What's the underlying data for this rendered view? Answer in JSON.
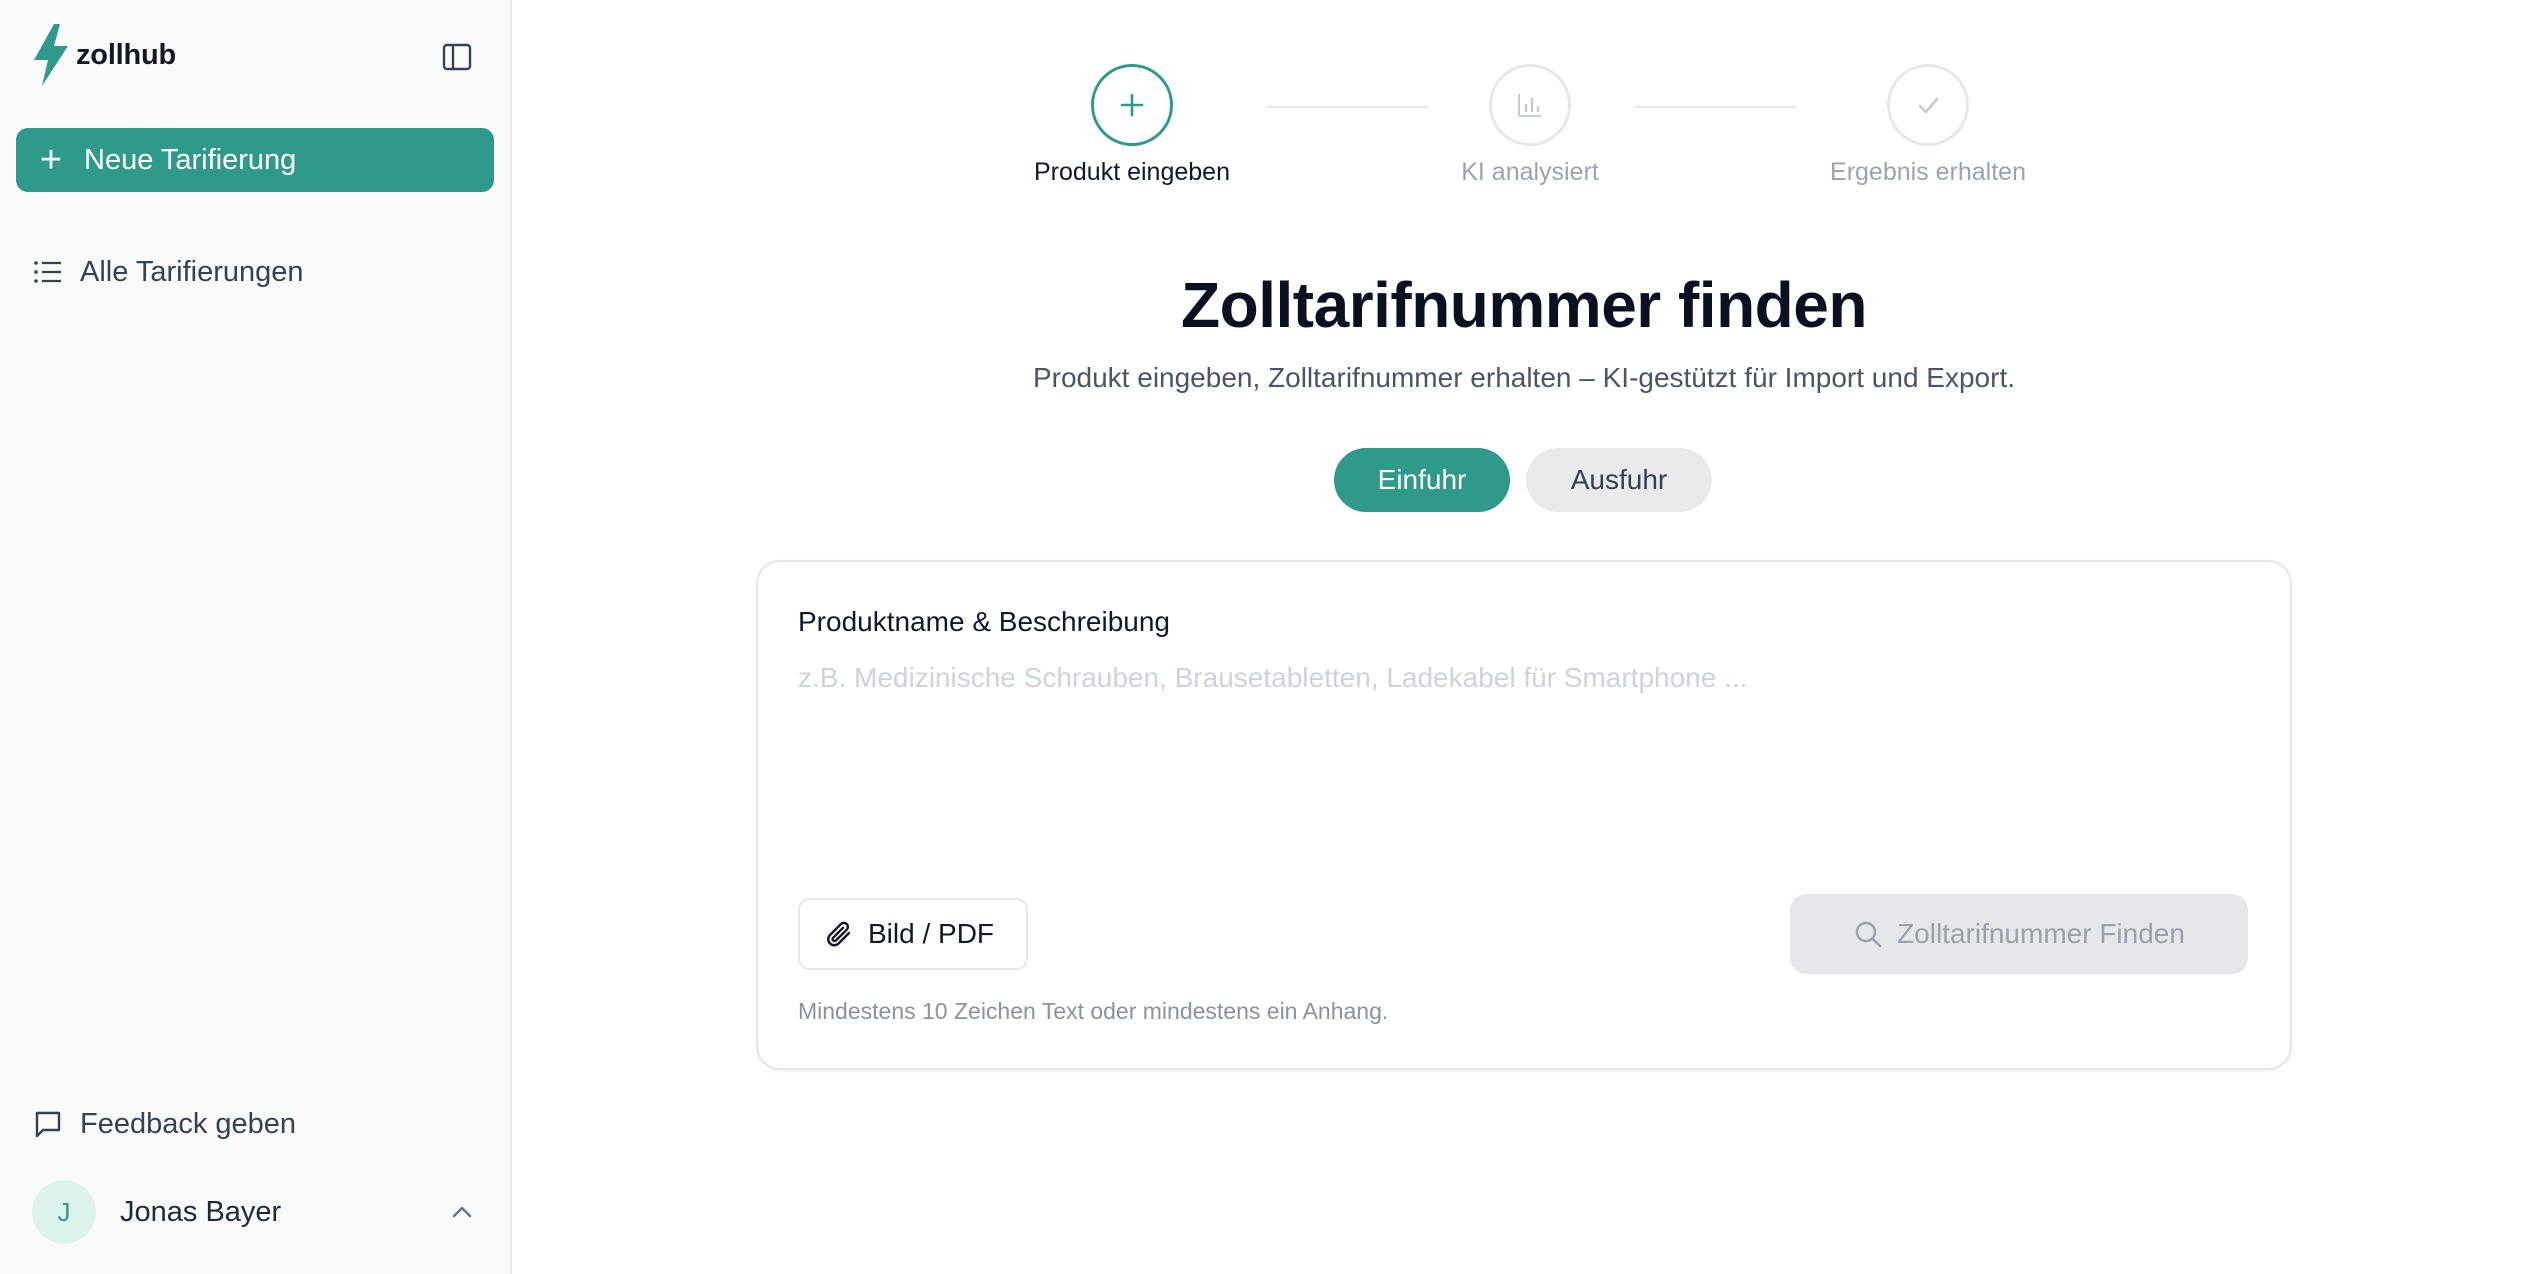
{
  "app": {
    "name": "zollhub",
    "brand_color": "#2f9a8a"
  },
  "sidebar": {
    "new_button_label": "Neue Tarifierung",
    "all_label": "Alle Tarifierungen",
    "feedback_label": "Feedback geben",
    "user": {
      "initial": "J",
      "name": "Jonas Bayer"
    }
  },
  "steps": [
    {
      "label": "Produkt eingeben",
      "icon": "plus-icon",
      "state": "active"
    },
    {
      "label": "KI analysiert",
      "icon": "bar-chart-icon",
      "state": "inactive"
    },
    {
      "label": "Ergebnis erhalten",
      "icon": "check-icon",
      "state": "inactive"
    }
  ],
  "main": {
    "title": "Zolltarifnummer finden",
    "subtitle": "Produkt eingeben, Zolltarifnummer erhalten – KI-gestützt für Import und Export.",
    "mode_options": [
      "Einfuhr",
      "Ausfuhr"
    ],
    "mode_selected": "Einfuhr"
  },
  "form": {
    "field_label": "Produktname & Beschreibung",
    "placeholder": "z.B. Medizinische Schrauben, Brausetabletten, Ladekabel für Smartphone ...",
    "value": "",
    "attach_label": "Bild / PDF",
    "submit_label": "Zolltarifnummer Finden",
    "hint": "Mindestens 10 Zeichen Text oder mindestens ein Anhang."
  }
}
